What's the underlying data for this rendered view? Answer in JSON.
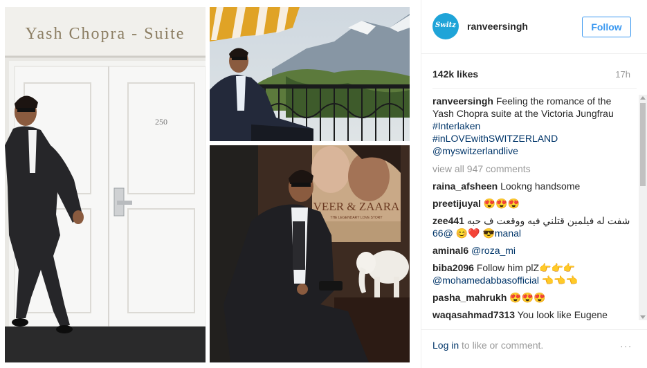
{
  "post": {
    "photos": {
      "left_sign": "Yash  Chopra - Suite",
      "door_number": "250",
      "poster_title": "VEER & ZAARA",
      "poster_subtitle": "THE LEGENDARY LOVE STORY"
    },
    "header": {
      "avatar_text": "Switz",
      "username": "ranveersingh",
      "follow_label": "Follow"
    },
    "likes": "142k likes",
    "time": "17h",
    "caption": {
      "user": "ranveersingh",
      "text": "Feeling the romance of the Yash Chopra suite at the Victoria Jungfrau",
      "tags": [
        "#Interlaken",
        "#inLOVEwithSWITZERLAND",
        "@myswitzerlandlive"
      ]
    },
    "view_all": "view all 947 comments",
    "comments": [
      {
        "user": "raina_afsheen",
        "text": "Lookng handsome",
        "mention": ""
      },
      {
        "user": "preetijuyal",
        "text": "😍😍😍",
        "mention": ""
      },
      {
        "user": "zee441",
        "text": "شفت له فيلمين قتلني فيه ووقعت ف حبه 😎 ❤️😊",
        "mention": "@66manal"
      },
      {
        "user": "aminal6",
        "text": "",
        "mention": "@roza_mi"
      },
      {
        "user": "biba2096",
        "text": "Follow him plZ👉👉👉",
        "mention": "@mohamedabbasofficial 👈👈👈"
      },
      {
        "user": "pasha_mahrukh",
        "text": "😍😍😍",
        "mention": ""
      },
      {
        "user": "waqasahmad7313",
        "text": "You look like Eugene",
        "mention": ""
      }
    ],
    "footer": {
      "login_link": "Log in",
      "login_rest": "to like or comment.",
      "more": "..."
    }
  }
}
